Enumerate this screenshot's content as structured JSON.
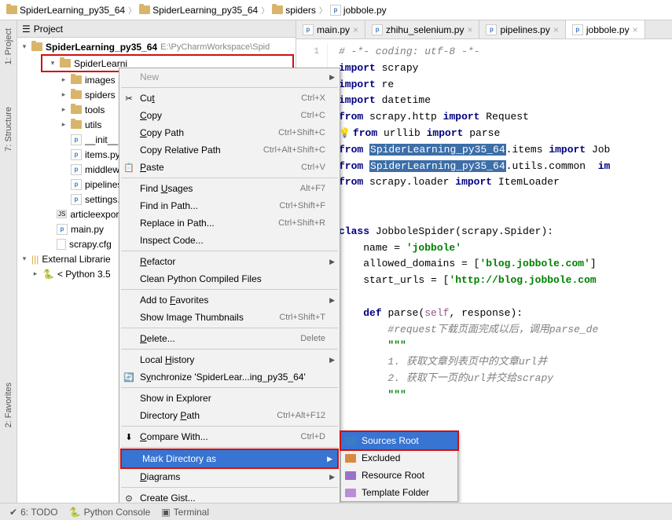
{
  "breadcrumb": [
    {
      "type": "folder",
      "label": "SpiderLearning_py35_64"
    },
    {
      "type": "folder",
      "label": "SpiderLearning_py35_64"
    },
    {
      "type": "folder",
      "label": "spiders"
    },
    {
      "type": "py",
      "label": "jobbole.py"
    }
  ],
  "panel": {
    "title": "Project"
  },
  "left_rail": {
    "project": "1: Project",
    "structure": "7: Structure",
    "favorites": "2: Favorites"
  },
  "tree": {
    "root": {
      "label": "SpiderLearning_py35_64",
      "path": "E:\\PyCharmWorkspace\\Spid"
    },
    "sub": {
      "label": "SpiderLearni"
    },
    "folders": [
      "images",
      "spiders",
      "tools",
      "utils"
    ],
    "files": [
      "__init__.py",
      "items.py",
      "middlewa",
      "pipelines",
      "settings.p"
    ],
    "other": [
      "articleexport",
      "main.py",
      "scrapy.cfg"
    ],
    "ext_lib": "External Librarie",
    "python": "< Python 3.5"
  },
  "tabs": [
    {
      "label": "main.py",
      "active": false
    },
    {
      "label": "zhihu_selenium.py",
      "active": false
    },
    {
      "label": "pipelines.py",
      "active": false
    },
    {
      "label": "jobbole.py",
      "active": true
    }
  ],
  "context_menu": {
    "items": [
      {
        "label": "New",
        "arrow": true,
        "dim": true
      },
      {
        "sep": true
      },
      {
        "label": "Cut",
        "mn": "t",
        "icon": "✂",
        "shortcut": "Ctrl+X"
      },
      {
        "label": "Copy",
        "mn": "C",
        "shortcut": "Ctrl+C"
      },
      {
        "label": "Copy Path",
        "mn": "C",
        "shortcut": "Ctrl+Shift+C"
      },
      {
        "label": "Copy Relative Path",
        "shortcut": "Ctrl+Alt+Shift+C"
      },
      {
        "label": "Paste",
        "mn": "P",
        "icon": "📋",
        "shortcut": "Ctrl+V"
      },
      {
        "sep": true
      },
      {
        "label": "Find Usages",
        "mn": "U",
        "shortcut": "Alt+F7"
      },
      {
        "label": "Find in Path...",
        "shortcut": "Ctrl+Shift+F"
      },
      {
        "label": "Replace in Path...",
        "shortcut": "Ctrl+Shift+R"
      },
      {
        "label": "Inspect Code..."
      },
      {
        "sep": true
      },
      {
        "label": "Refactor",
        "mn": "R",
        "arrow": true
      },
      {
        "label": "Clean Python Compiled Files"
      },
      {
        "sep": true
      },
      {
        "label": "Add to Favorites",
        "mn": "F",
        "arrow": true
      },
      {
        "label": "Show Image Thumbnails",
        "shortcut": "Ctrl+Shift+T"
      },
      {
        "sep": true
      },
      {
        "label": "Delete...",
        "mn": "D",
        "shortcut": "Delete"
      },
      {
        "sep": true
      },
      {
        "label": "Local History",
        "mn": "H",
        "arrow": true
      },
      {
        "label": "Synchronize 'SpiderLear...ing_py35_64'",
        "mn": "y",
        "icon": "🔄"
      },
      {
        "sep": true
      },
      {
        "label": "Show in Explorer"
      },
      {
        "label": "Directory Path",
        "mn": "P",
        "shortcut": "Ctrl+Alt+F12"
      },
      {
        "sep": true
      },
      {
        "label": "Compare With...",
        "mn": "C",
        "icon": "⬇",
        "shortcut": "Ctrl+D"
      },
      {
        "sep": true
      },
      {
        "label": "Mark Directory as",
        "selected": true,
        "arrow": true,
        "redbox": true
      },
      {
        "label": "Diagrams",
        "mn": "D",
        "arrow": true
      },
      {
        "sep": true
      },
      {
        "label": "Create Gist...",
        "icon": "⊙"
      }
    ]
  },
  "submenu": {
    "items": [
      {
        "label": "Sources Root",
        "color": "#3b7dc4",
        "selected": true
      },
      {
        "label": "Excluded",
        "color": "#d88b3f"
      },
      {
        "label": "Resource Root",
        "color": "#9a72c9"
      },
      {
        "label": "Template Folder",
        "color": "#b98ed6"
      }
    ]
  },
  "code": {
    "c1": "# -*- coding: utf-8 -*-",
    "kw_import": "import",
    "kw_from": "from",
    "kw_class": "class",
    "kw_def": "def",
    "imp1": "scrapy",
    "imp2": "re",
    "imp3": "datetime",
    "from_http": "scrapy.http",
    "req": "Request",
    "from_urllib": "urllib",
    "parse": "parse",
    "pkg_hl": "SpiderLearning_py35_64",
    "items": "items",
    "job": "Job",
    "utils_common": "utils.common",
    "im": "im",
    "loader_from": "scrapy.loader",
    "itemloader": "ItemLoader",
    "classname": "JobboleSpider(scrapy.Spider):",
    "name_eq": "name = ",
    "name_val": "'jobbole'",
    "allowed_eq": "allowed_domains = [",
    "allowed_val": "'blog.jobbole.com'",
    "bracket_close": "]",
    "start_eq": "start_urls = [",
    "start_val": "'http://blog.jobbole.com",
    "parse_def": "parse(",
    "self": "self",
    "resp": ", response):",
    "cmt_req": "#request",
    "cmt_req_cn": "下载页面完成以后，调用",
    "cmt_parse_de": "parse_de",
    "triple": "\"\"\"",
    "cmt_n1": "1. 获取文章列表页中的文章url并",
    "cmt_n2": "2. 获取下一页的url并交给",
    "cmt_scrapy": "scrapy"
  },
  "bottom": {
    "todo": "6: TODO",
    "console": "Python Console",
    "terminal": "Terminal"
  }
}
